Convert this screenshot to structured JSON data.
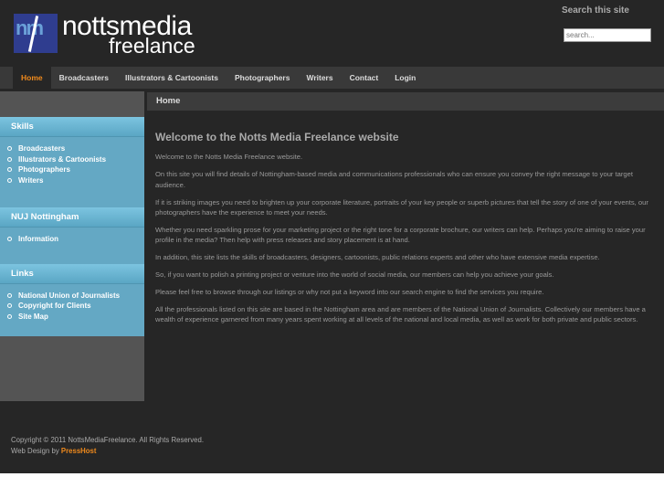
{
  "header": {
    "logo_mark": "nm",
    "brand_line1": "nottsmedia",
    "brand_line2": "freelance",
    "search_label": "Search this site",
    "search_placeholder": "search..."
  },
  "nav": [
    {
      "label": "Home",
      "active": true
    },
    {
      "label": "Broadcasters"
    },
    {
      "label": "Illustrators & Cartoonists"
    },
    {
      "label": "Photographers"
    },
    {
      "label": "Writers"
    },
    {
      "label": "Contact"
    },
    {
      "label": "Login"
    }
  ],
  "breadcrumb": "Home",
  "sidebar": {
    "sections": [
      {
        "title": "Skills",
        "items": [
          "Broadcasters",
          "Illustrators & Cartoonists",
          "Photographers",
          "Writers"
        ]
      },
      {
        "title": "NUJ Nottingham",
        "items": [
          "Information"
        ]
      },
      {
        "title": "Links",
        "items": [
          "National Union of Journalists",
          "Copyright for Clients",
          "Site Map"
        ]
      }
    ]
  },
  "main": {
    "title": "Welcome to the Notts Media Freelance website",
    "paragraphs": [
      "Welcome to the Notts Media Freelance website.",
      "On this site you will find details of Nottingham-based media and communications professionals who can ensure you convey the right message to your target audience.",
      "If it is striking images you need to brighten up your corporate literature, portraits of your key people or superb pictures that tell the story of one of your events, our photographers have the experience to meet your needs.",
      "Whether you need sparkling prose for your marketing project or the right tone for a corporate brochure, our writers can help. Perhaps you're aiming to raise your profile in the media? Then help with press releases and story placement is at hand.",
      "In addition, this site lists the skills of broadcasters, designers, cartoonists, public relations experts and other who have extensive media expertise.",
      "So, if you want to polish a printing project or venture into the world of social media, our members can help you achieve your goals.",
      "Please feel free to browse through our listings or why not put a keyword into our search engine to find the services you require.",
      "All the professionals listed on this site are based in the Nottingham area and are members of the National Union of Journalists. Collectively our members have a wealth of experience garnered from many years spent working at all levels of the national and local media, as well as work for both private and public sectors."
    ]
  },
  "footer": {
    "copyright": "Copyright © 2011 NottsMediaFreelance. All Rights Reserved.",
    "design_prefix": "Web Design by",
    "design_link": "PressHost"
  }
}
